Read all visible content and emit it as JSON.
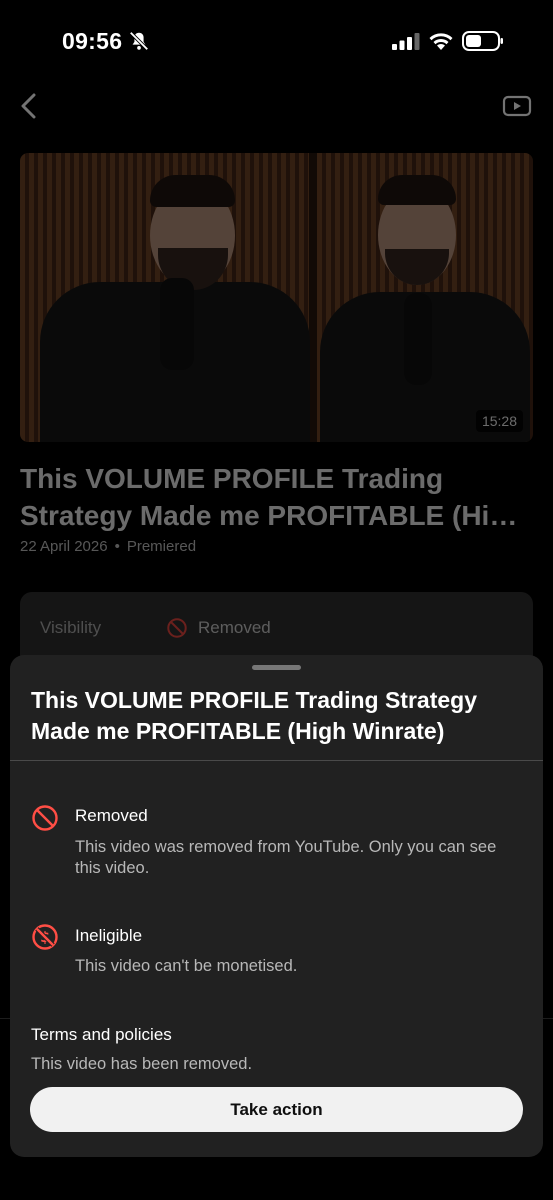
{
  "status_bar": {
    "time": "09:56",
    "icons": [
      "bell-slash-icon",
      "cellular-signal-icon",
      "wifi-icon",
      "battery-icon"
    ]
  },
  "app_bar": {
    "back_icon": "chevron-left-icon",
    "youtube_icon": "youtube-icon"
  },
  "video": {
    "duration": "15:28",
    "title": "This VOLUME PROFILE Trading Strategy Made me PROFITABLE (Hi…",
    "date": "22 April 2026",
    "separator": "•",
    "status": "Premiered"
  },
  "visibility": {
    "label": "Visibility",
    "icon": "prohibited-icon",
    "value": "Removed"
  },
  "sheet": {
    "title": "This VOLUME PROFILE Trading Strategy Made me PROFITABLE (High Winrate)",
    "items": [
      {
        "icon": "prohibited-icon",
        "label": "Removed",
        "description": "This video was removed from YouTube. Only you can see this video."
      },
      {
        "icon": "monetisation-off-icon",
        "label": "Ineligible",
        "description": "This video can't be monetised."
      }
    ],
    "terms_label": "Terms and policies",
    "terms_description": "This video has been removed.",
    "action_button": "Take action"
  },
  "colors": {
    "background": "#000000",
    "sheet": "#212121",
    "error_red": "#ff4e45",
    "button_bg": "#f1f1f1"
  }
}
